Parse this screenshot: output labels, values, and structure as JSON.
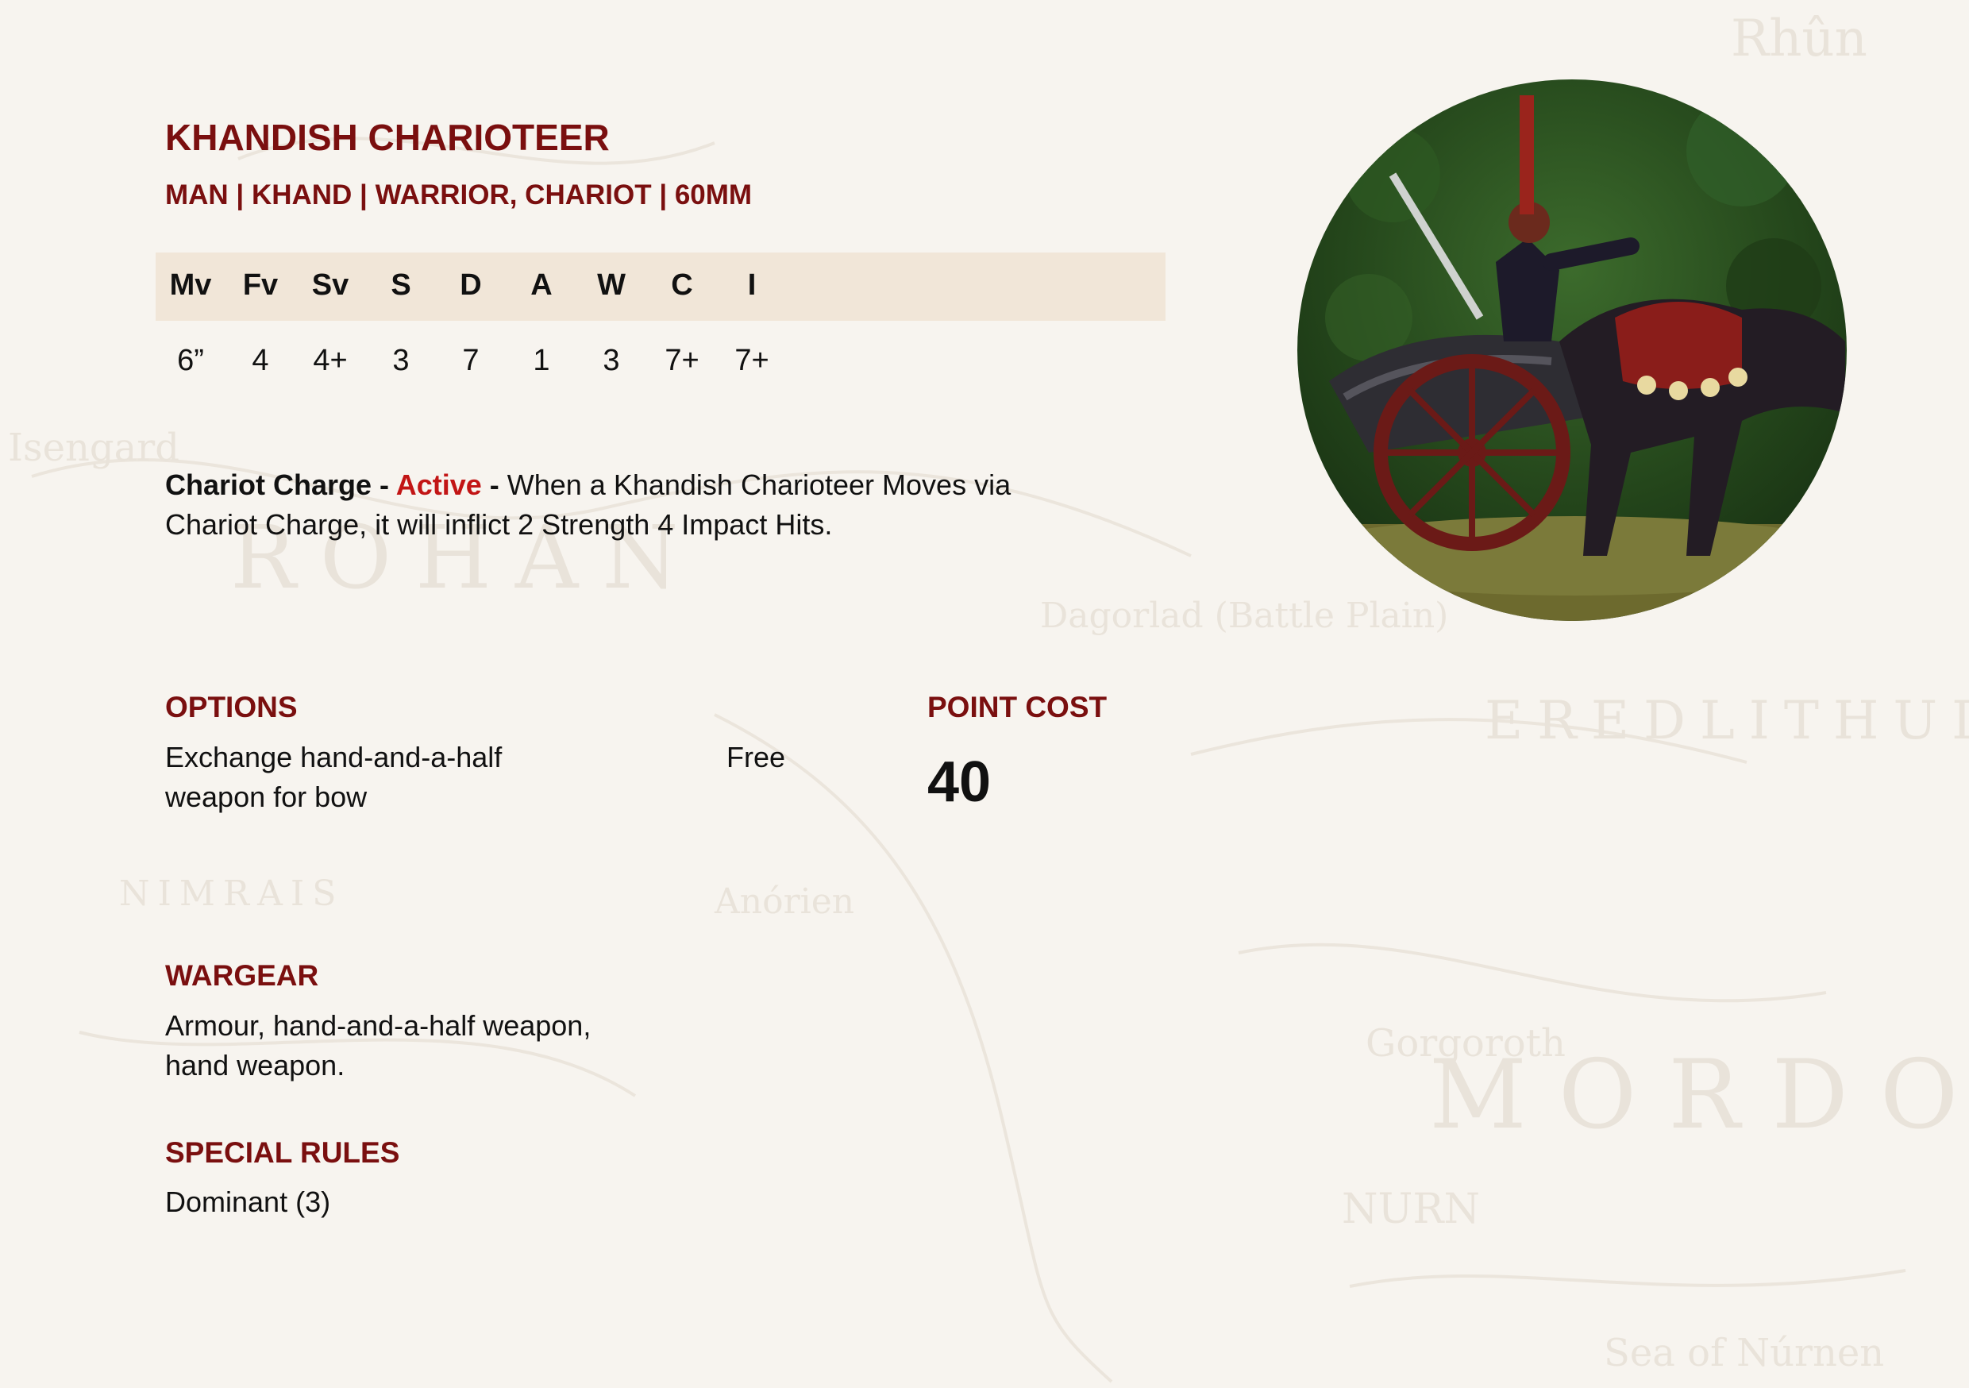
{
  "unit": {
    "name": "KHANDISH CHARIOTEER",
    "keywords": "MAN | KHAND | WARRIOR, CHARIOT | 60MM"
  },
  "stats": {
    "headers": [
      "Mv",
      "Fv",
      "Sv",
      "S",
      "D",
      "A",
      "W",
      "C",
      "I"
    ],
    "values": [
      "6”",
      "4",
      "4+",
      "3",
      "7",
      "1",
      "3",
      "7+",
      "7+"
    ]
  },
  "active_rule": {
    "name": "Chariot Charge",
    "sep1": " - ",
    "type": "Active",
    "sep2": " - ",
    "text": "When a Khandish Charioteer Moves via Chariot Charge, it will inflict 2 Strength 4 Impact Hits."
  },
  "options": {
    "heading": "OPTIONS",
    "items": [
      {
        "text": "Exchange hand-and-a-half weapon for bow",
        "cost": "Free"
      }
    ]
  },
  "point_cost": {
    "heading": "POINT COST",
    "value": "40"
  },
  "wargear": {
    "heading": "WARGEAR",
    "text": "Armour, hand-and-a-half weapon, hand weapon."
  },
  "special_rules": {
    "heading": "SPECIAL RULES",
    "text": "Dominant (3)"
  },
  "background_map_labels": [
    "Rhûn",
    "MORDOR",
    "NURN",
    "Dagorlad (Battle Plain)",
    "EREDLITHUI",
    "Gorgoroth",
    "Isengard",
    "ROHAN",
    "Sea of Núrnen",
    "Anórien",
    "NIMRAIS"
  ],
  "colors": {
    "heading": "#7a0f0f",
    "active": "#c21515",
    "stat_band": "#f1e6d8",
    "page": "#f7f4ef"
  }
}
